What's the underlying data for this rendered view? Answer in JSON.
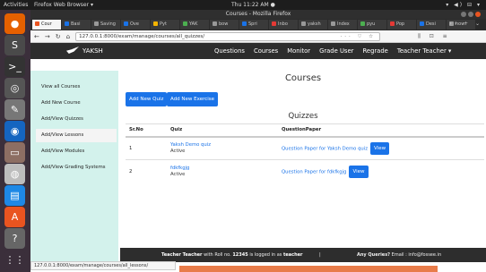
{
  "system": {
    "activities": "Activities",
    "app_menu": "Firefox Web Browser ▾",
    "clock": "Thu 11:22 AM ●",
    "tray": "▾ ◀) ⊟ ▾"
  },
  "browser": {
    "title": "Courses - Mozilla Firefox",
    "tabs": [
      {
        "label": "Cour",
        "color": "#e95420",
        "active": true
      },
      {
        "label": "Basi",
        "color": "#1a73e8"
      },
      {
        "label": "Saving",
        "color": "#999999"
      },
      {
        "label": "Ove",
        "color": "#1a73e8"
      },
      {
        "label": "Pyt",
        "color": "#f4b400"
      },
      {
        "label": "YAK",
        "color": "#4caf50"
      },
      {
        "label": "bow",
        "color": "#999999"
      },
      {
        "label": "Spri",
        "color": "#1a73e8"
      },
      {
        "label": "Inbo",
        "color": "#e53935"
      },
      {
        "label": "yaksh",
        "color": "#999999"
      },
      {
        "label": "Index",
        "color": "#999999"
      },
      {
        "label": "pyu",
        "color": "#4caf50"
      },
      {
        "label": "Pop",
        "color": "#e53935"
      },
      {
        "label": "Desi",
        "color": "#1a73e8"
      },
      {
        "label": "how",
        "color": "#999999"
      }
    ],
    "tab_controls": "››  +  ⌄",
    "url": "127.0.0.1:8000/exam/manage/courses/all_quizzes/",
    "url_buttons": "··· ♡ ☆",
    "nav_icons": "⫼ ⊡ ≡",
    "status_url": "127.0.0.1:8000/exam/manage/courses/all_lessons/"
  },
  "dock": {
    "icons": [
      {
        "name": "firefox-icon",
        "color": "#e66000",
        "glyph": "●"
      },
      {
        "name": "sublime-icon",
        "color": "#4a4a4a",
        "glyph": "S"
      },
      {
        "name": "terminal-icon",
        "color": "#333333",
        "glyph": ">_"
      },
      {
        "name": "screenshot-icon",
        "color": "#555555",
        "glyph": "◎"
      },
      {
        "name": "text-editor-icon",
        "color": "#777777",
        "glyph": "✎"
      },
      {
        "name": "chromium-icon",
        "color": "#1565c0",
        "glyph": "◉"
      },
      {
        "name": "files-icon",
        "color": "#8d6e63",
        "glyph": "▭"
      },
      {
        "name": "disk-icon",
        "color": "#bdbdbd",
        "glyph": "◍"
      },
      {
        "name": "writer-icon",
        "color": "#1e88e5",
        "glyph": "▤"
      },
      {
        "name": "software-icon",
        "color": "#e95420",
        "glyph": "A"
      },
      {
        "name": "help-icon",
        "color": "#666666",
        "glyph": "?"
      },
      {
        "name": "apps-grid-icon",
        "color": "#3b2f3b",
        "glyph": "⋮⋮"
      }
    ]
  },
  "header": {
    "brand": "YAKSH",
    "nav": [
      "Questions",
      "Courses",
      "Monitor",
      "Grade User",
      "Regrade",
      "Teacher Teacher ▾"
    ]
  },
  "sidebar": {
    "items": [
      {
        "label": "View all Courses"
      },
      {
        "label": "Add New Course"
      },
      {
        "label": "Add/View Quizzes"
      },
      {
        "label": "Add/View Lessons",
        "active": true
      },
      {
        "label": "Add/View Modules"
      },
      {
        "label": "Add/View Grading Systems"
      }
    ]
  },
  "main": {
    "title": "Courses",
    "add_quiz_label": "Add New Quiz",
    "add_exercise_label": "Add New Exercise",
    "section_title": "Quizzes",
    "table": {
      "headers": [
        "Sr.No",
        "Quiz",
        "QuestionPaper"
      ],
      "rows": [
        {
          "sr": "1",
          "quiz": "Yaksh Demo quiz",
          "status": "Active",
          "paper": "Question Paper for Yaksh Demo quiz",
          "view": "View"
        },
        {
          "sr": "2",
          "quiz": "fdkfkgjg",
          "status": "Active",
          "paper": "Question Paper for fdkfkgjg",
          "view": "View"
        }
      ]
    }
  },
  "footer": {
    "left_prefix": "Teacher Teacher",
    "left_mid": " with Roll no. ",
    "roll": "12345",
    "left_suffix": " is logged in as ",
    "role": "teacher",
    "separator": "|",
    "queries_label": "Any Queries?",
    "queries_text": " Email : info@fossee.in"
  }
}
